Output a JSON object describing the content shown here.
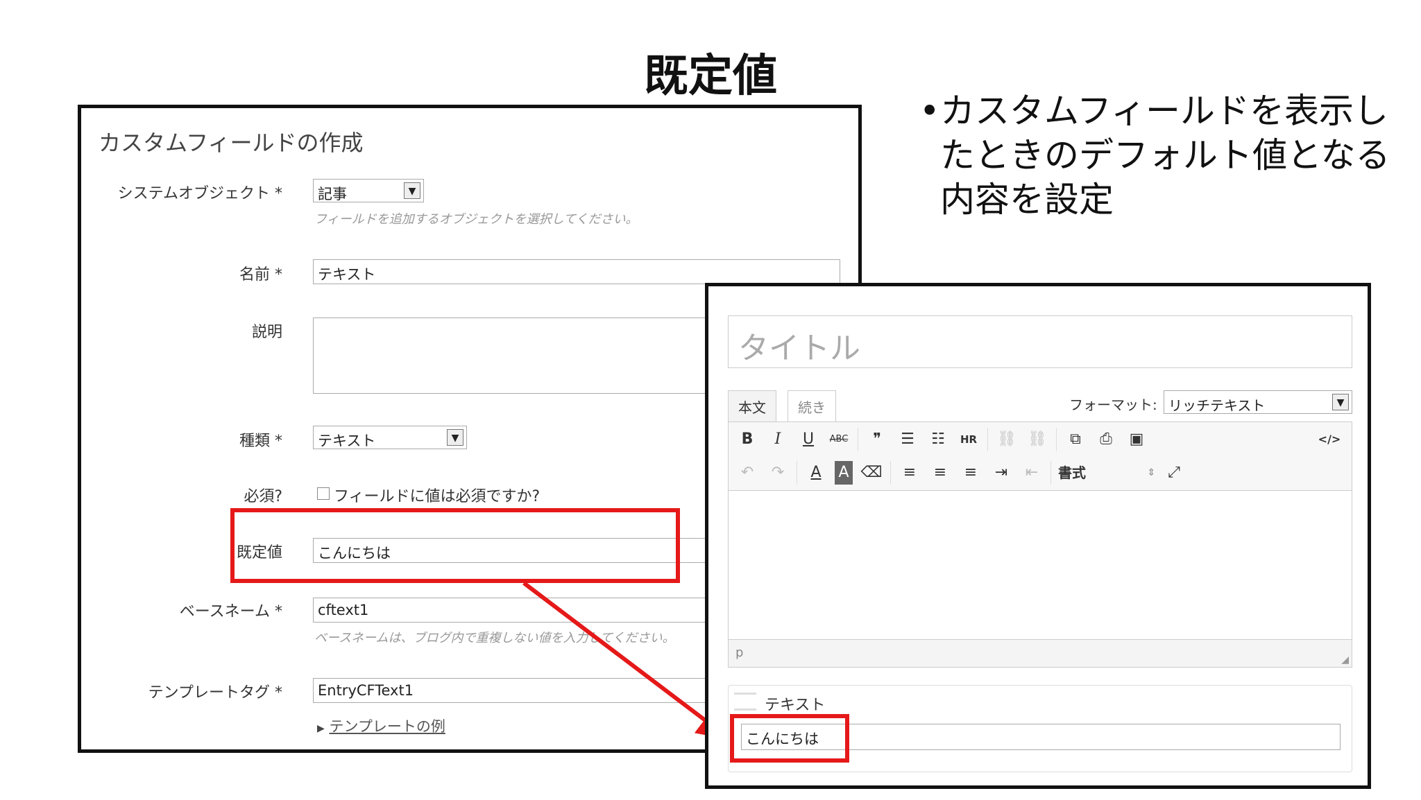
{
  "slide": {
    "title": "既定値",
    "bullet": "カスタムフィールドを表示したときのデフォルト値となる内容を設定"
  },
  "form": {
    "heading": "カスタムフィールドの作成",
    "system_object_label": "システムオブジェクト *",
    "system_object_value": "記事",
    "system_object_hint": "フィールドを追加するオブジェクトを選択してください。",
    "name_label": "名前 *",
    "name_value": "テキスト",
    "description_label": "説明",
    "type_label": "種類 *",
    "type_value": "テキスト",
    "required_label": "必須?",
    "required_text": "フィールドに値は必須ですか?",
    "default_label": "既定値",
    "default_value": "こんにちは",
    "basename_label": "ベースネーム *",
    "basename_value": "cftext1",
    "basename_hint": "ベースネームは、ブログ内で重複しない値を入力してください。",
    "template_tag_label": "テンプレートタグ *",
    "template_tag_value": "EntryCFText1",
    "template_example_link": "テンプレートの例"
  },
  "editor": {
    "title_placeholder": "タイトル",
    "tab_body": "本文",
    "tab_more": "続き",
    "format_label": "フォーマット:",
    "format_value": "リッチテキスト",
    "toolbar_row1": [
      "B",
      "I",
      "U",
      "ABC",
      "❞",
      "☰",
      "☷",
      "HR",
      "⛓",
      "⛓",
      "⧉",
      "⎙",
      "▣",
      "</>"
    ],
    "toolbar_row2": [
      "↶",
      "↷",
      "A",
      "A",
      "⌫",
      "≡",
      "≡",
      "≡",
      "⇥",
      "⇤"
    ],
    "style_select": "書式",
    "status_path": "p",
    "custom_field_label": "テキスト",
    "custom_field_value": "こんにちは"
  },
  "colors": {
    "highlight": "#e51919",
    "border": "#111111"
  }
}
